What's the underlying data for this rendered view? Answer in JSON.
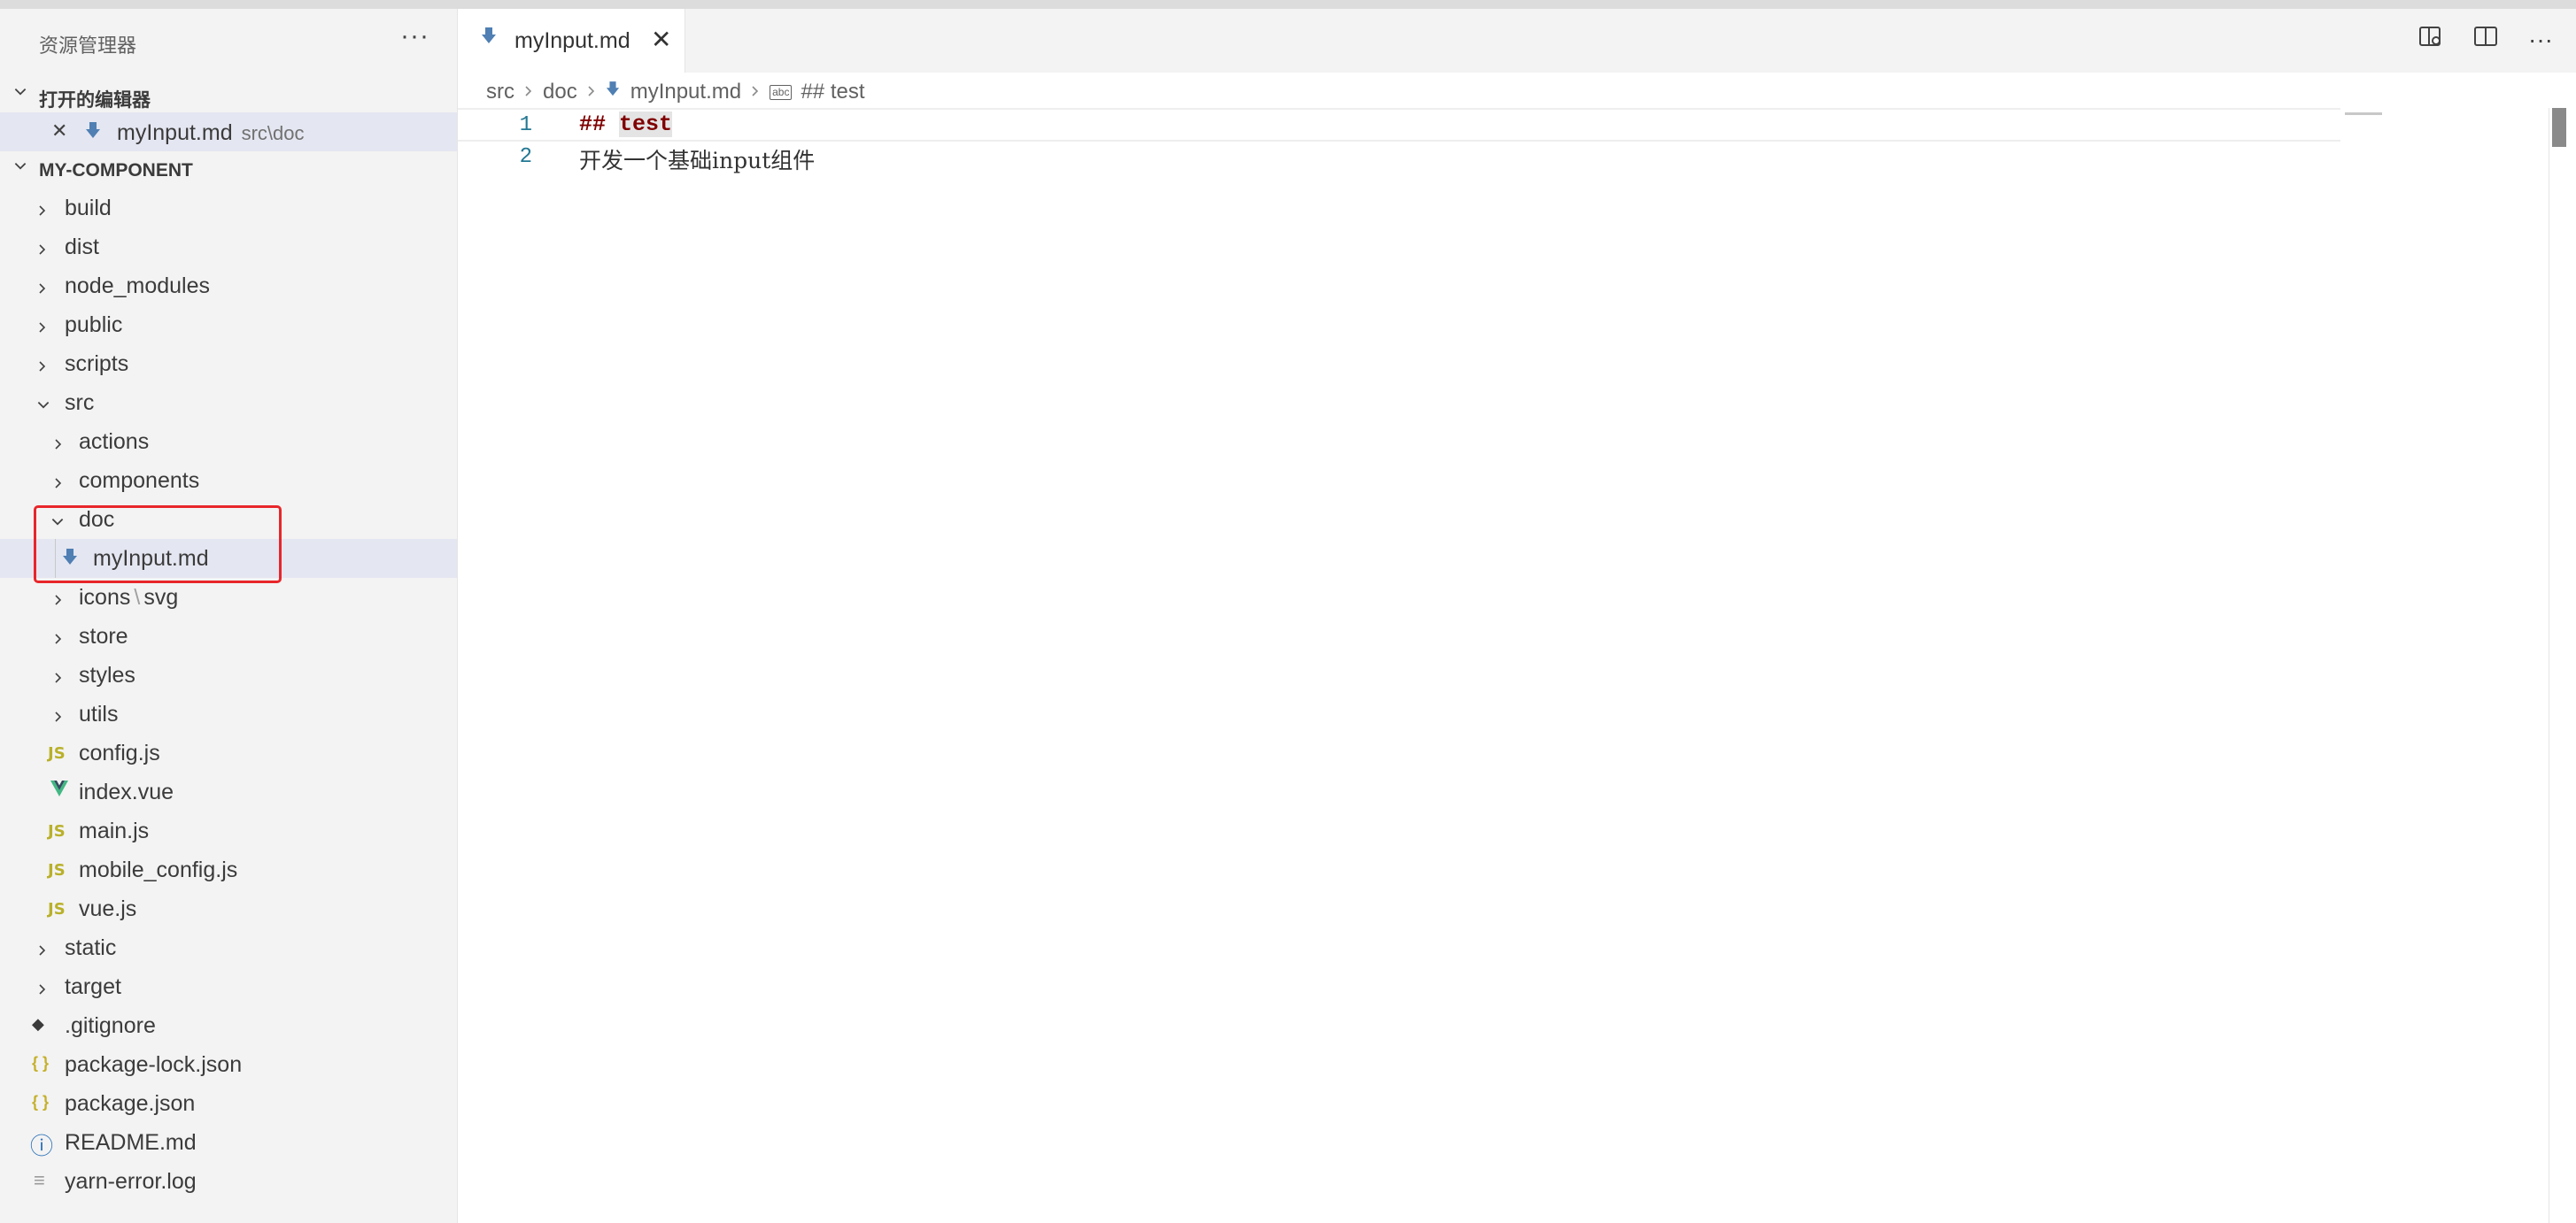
{
  "explorer": {
    "title": "资源管理器",
    "more": "···",
    "open_editors": {
      "title": "打开的编辑器",
      "items": [
        {
          "name": "myInput.md",
          "path": "src\\doc",
          "close": "✕"
        }
      ]
    },
    "project": {
      "title": "MY-COMPONENT",
      "tree": {
        "build": "build",
        "dist": "dist",
        "node_modules": "node_modules",
        "public": "public",
        "scripts": "scripts",
        "src": "src",
        "actions": "actions",
        "components": "components",
        "doc": "doc",
        "myinput": "myInput.md",
        "icons": "icons",
        "icons_sep": "\\",
        "svg": "svg",
        "store": "store",
        "styles": "styles",
        "utils": "utils",
        "config_js": "config.js",
        "index_vue": "index.vue",
        "main_js": "main.js",
        "mobile_config_js": "mobile_config.js",
        "vue_js": "vue.js",
        "static": "static",
        "target": "target",
        "gitignore": ".gitignore",
        "package_lock": "package-lock.json",
        "package_json": "package.json",
        "readme": "README.md",
        "yarn_error": "yarn-error.log"
      }
    },
    "icons": {
      "js": "JS",
      "json": "{ }",
      "vue": "V",
      "info": "ⓘ",
      "git": "◆",
      "log": "≡"
    }
  },
  "editor": {
    "tab": {
      "label": "myInput.md",
      "close": "✕"
    },
    "breadcrumb": [
      "src",
      "doc",
      "myInput.md",
      "## test"
    ],
    "breadcrumb_symbol": "abc",
    "lines": [
      {
        "number": "1",
        "hash": "##",
        "word": "test"
      },
      {
        "number": "2",
        "text": "开发一个基础input组件"
      }
    ],
    "actions": {
      "more": "···"
    }
  },
  "colors": {
    "selection": "#e4e6f1",
    "highlight_box": "#e8262a",
    "line_number": "#237893",
    "heading": "#800000"
  }
}
